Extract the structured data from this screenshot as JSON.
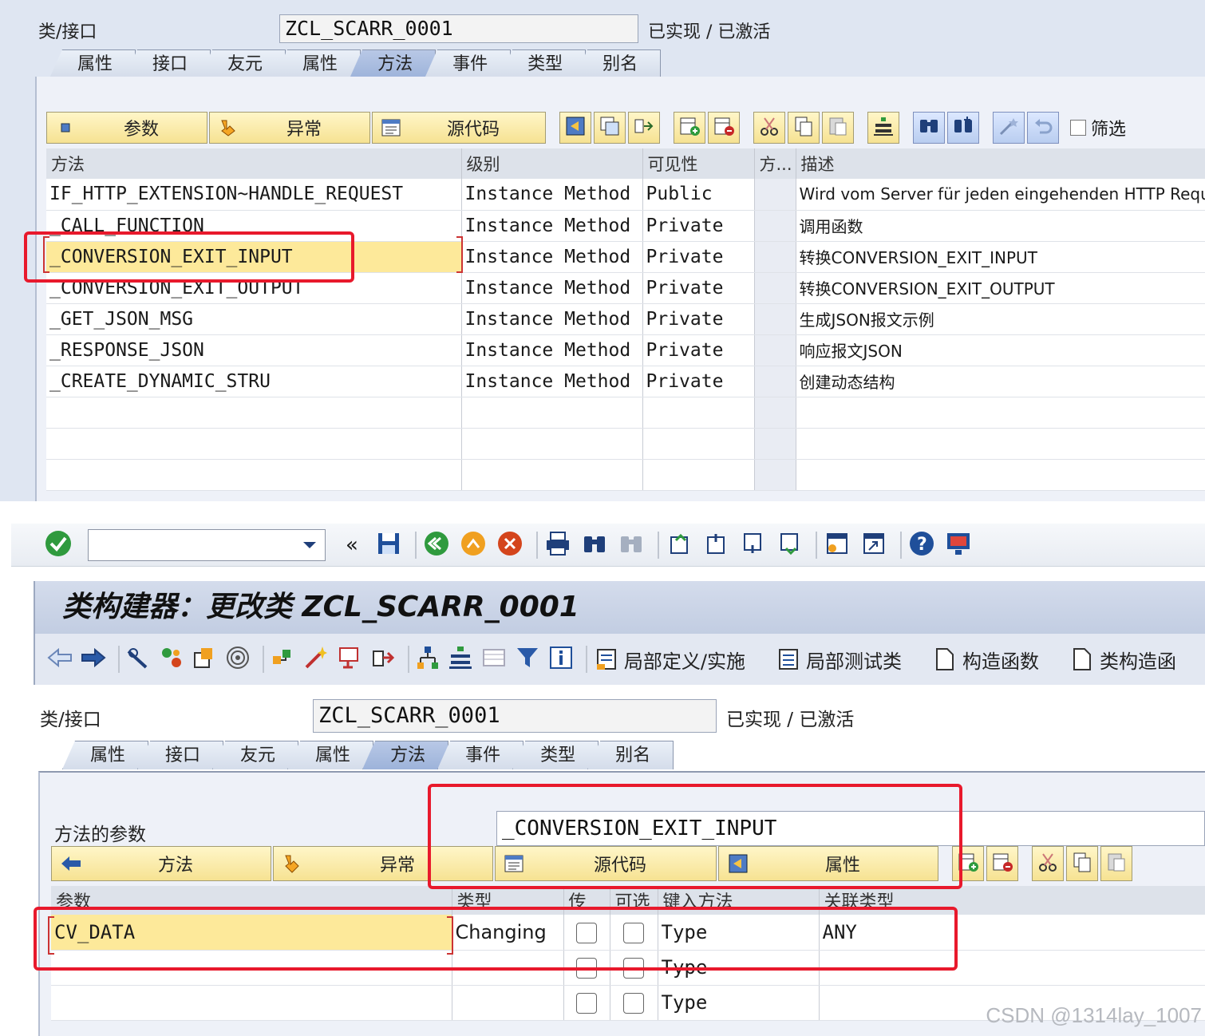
{
  "top": {
    "class_label": "类/接口",
    "class_name": "ZCL_SCARR_0001",
    "status": "已实现 / 已激活",
    "tabs": [
      {
        "label": "属性",
        "active": false
      },
      {
        "label": "接口",
        "active": false
      },
      {
        "label": "友元",
        "active": false
      },
      {
        "label": "属性",
        "active": false
      },
      {
        "label": "方法",
        "active": true
      },
      {
        "label": "事件",
        "active": false
      },
      {
        "label": "类型",
        "active": false
      },
      {
        "label": "别名",
        "active": false
      }
    ],
    "buttons": {
      "params": "参数",
      "exceptions": "异常",
      "source": "源代码",
      "filter": "筛选"
    },
    "table": {
      "headers": [
        "方法",
        "级别",
        "可见性",
        "方...",
        "描述"
      ],
      "rows": [
        {
          "name": "IF_HTTP_EXTENSION~HANDLE_REQUEST",
          "level": "Instance Method",
          "visibility": "Public",
          "desc": "Wird vom Server für jeden eingehenden HTTP Requ"
        },
        {
          "name": "_CALL_FUNCTION",
          "level": "Instance Method",
          "visibility": "Private",
          "desc": "调用函数"
        },
        {
          "name": "_CONVERSION_EXIT_INPUT",
          "level": "Instance Method",
          "visibility": "Private",
          "desc": "转换CONVERSION_EXIT_INPUT"
        },
        {
          "name": "_CONVERSION_EXIT_OUTPUT",
          "level": "Instance Method",
          "visibility": "Private",
          "desc": "转换CONVERSION_EXIT_OUTPUT"
        },
        {
          "name": "_GET_JSON_MSG",
          "level": "Instance Method",
          "visibility": "Private",
          "desc": "生成JSON报文示例"
        },
        {
          "name": "_RESPONSE_JSON",
          "level": "Instance Method",
          "visibility": "Private",
          "desc": "响应报文JSON"
        },
        {
          "name": "_CREATE_DYNAMIC_STRU",
          "level": "Instance Method",
          "visibility": "Private",
          "desc": "创建动态结构"
        }
      ]
    }
  },
  "bottom": {
    "title": "类构建器：更改类 ZCL_SCARR_0001",
    "toolbar_texts": {
      "local_def": "局部定义/实施",
      "local_test": "局部测试类",
      "constructor": "构造函数",
      "class_constructor": "类构造函"
    },
    "class_label": "类/接口",
    "class_name": "ZCL_SCARR_0001",
    "status": "已实现 / 已激活",
    "tabs": [
      {
        "label": "属性",
        "active": false
      },
      {
        "label": "接口",
        "active": false
      },
      {
        "label": "友元",
        "active": false
      },
      {
        "label": "属性",
        "active": false
      },
      {
        "label": "方法",
        "active": true
      },
      {
        "label": "事件",
        "active": false
      },
      {
        "label": "类型",
        "active": false
      },
      {
        "label": "别名",
        "active": false
      }
    ],
    "method_params_label": "方法的参数",
    "method_name": "_CONVERSION_EXIT_INPUT",
    "buttons": {
      "method": "方法",
      "exceptions": "异常",
      "source": "源代码",
      "attributes": "属性"
    },
    "param_table": {
      "headers": [
        "参数",
        "类型",
        "传",
        "可选",
        "键入方法",
        "关联类型"
      ],
      "rows": [
        {
          "param": "CV_DATA",
          "type": "Changing",
          "typing": "Type",
          "assoc": "ANY"
        },
        {
          "param": "",
          "type": "",
          "typing": "Type",
          "assoc": ""
        },
        {
          "param": "",
          "type": "",
          "typing": "Type",
          "assoc": ""
        }
      ]
    }
  },
  "watermark": "CSDN @1314lay_1007",
  "colors": {
    "highlight": "#e8192c",
    "yellow_button": "#f6e292",
    "active_tab": "#9db3da"
  }
}
